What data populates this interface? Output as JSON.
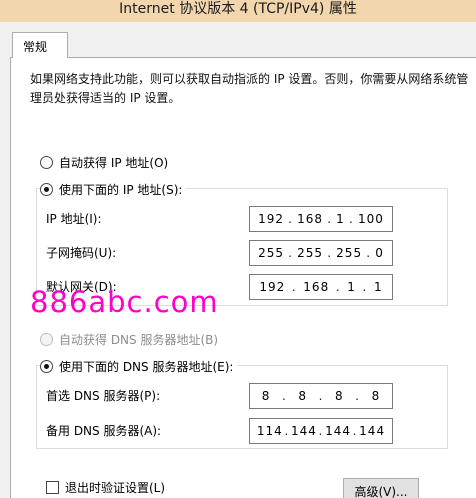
{
  "window": {
    "title": "Internet 协议版本 4 (TCP/IPv4) 属性"
  },
  "tabs": [
    {
      "label": "常规"
    }
  ],
  "description": "如果网络支持此功能，则可以获取自动指派的 IP 设置。否则，你需要从网络系统管理员处获得适当的 IP 设置。",
  "ip_mode": {
    "auto_label": "自动获得 IP 地址(O)",
    "manual_label": "使用下面的 IP 地址(S):",
    "selected": "manual"
  },
  "ip_fields": {
    "ip": {
      "label": "IP 地址(I):",
      "octets": [
        "192",
        "168",
        "1",
        "100"
      ]
    },
    "subnet": {
      "label": "子网掩码(U):",
      "octets": [
        "255",
        "255",
        "255",
        "0"
      ]
    },
    "gateway": {
      "label": "默认网关(D):",
      "octets": [
        "192",
        "168",
        "1",
        "1"
      ]
    }
  },
  "dns_mode": {
    "auto_label": "自动获得 DNS 服务器地址(B)",
    "manual_label": "使用下面的 DNS 服务器地址(E):",
    "selected": "manual"
  },
  "dns_fields": {
    "preferred": {
      "label": "首选 DNS 服务器(P):",
      "octets": [
        "8",
        "8",
        "8",
        "8"
      ]
    },
    "alternate": {
      "label": "备用 DNS 服务器(A):",
      "octets": [
        "114",
        "144",
        "144",
        "144"
      ]
    }
  },
  "validate_on_exit": {
    "label": "退出时验证设置(L)",
    "checked": false
  },
  "advanced_button": {
    "label": "高级(V)..."
  },
  "watermark": "886abc.com"
}
